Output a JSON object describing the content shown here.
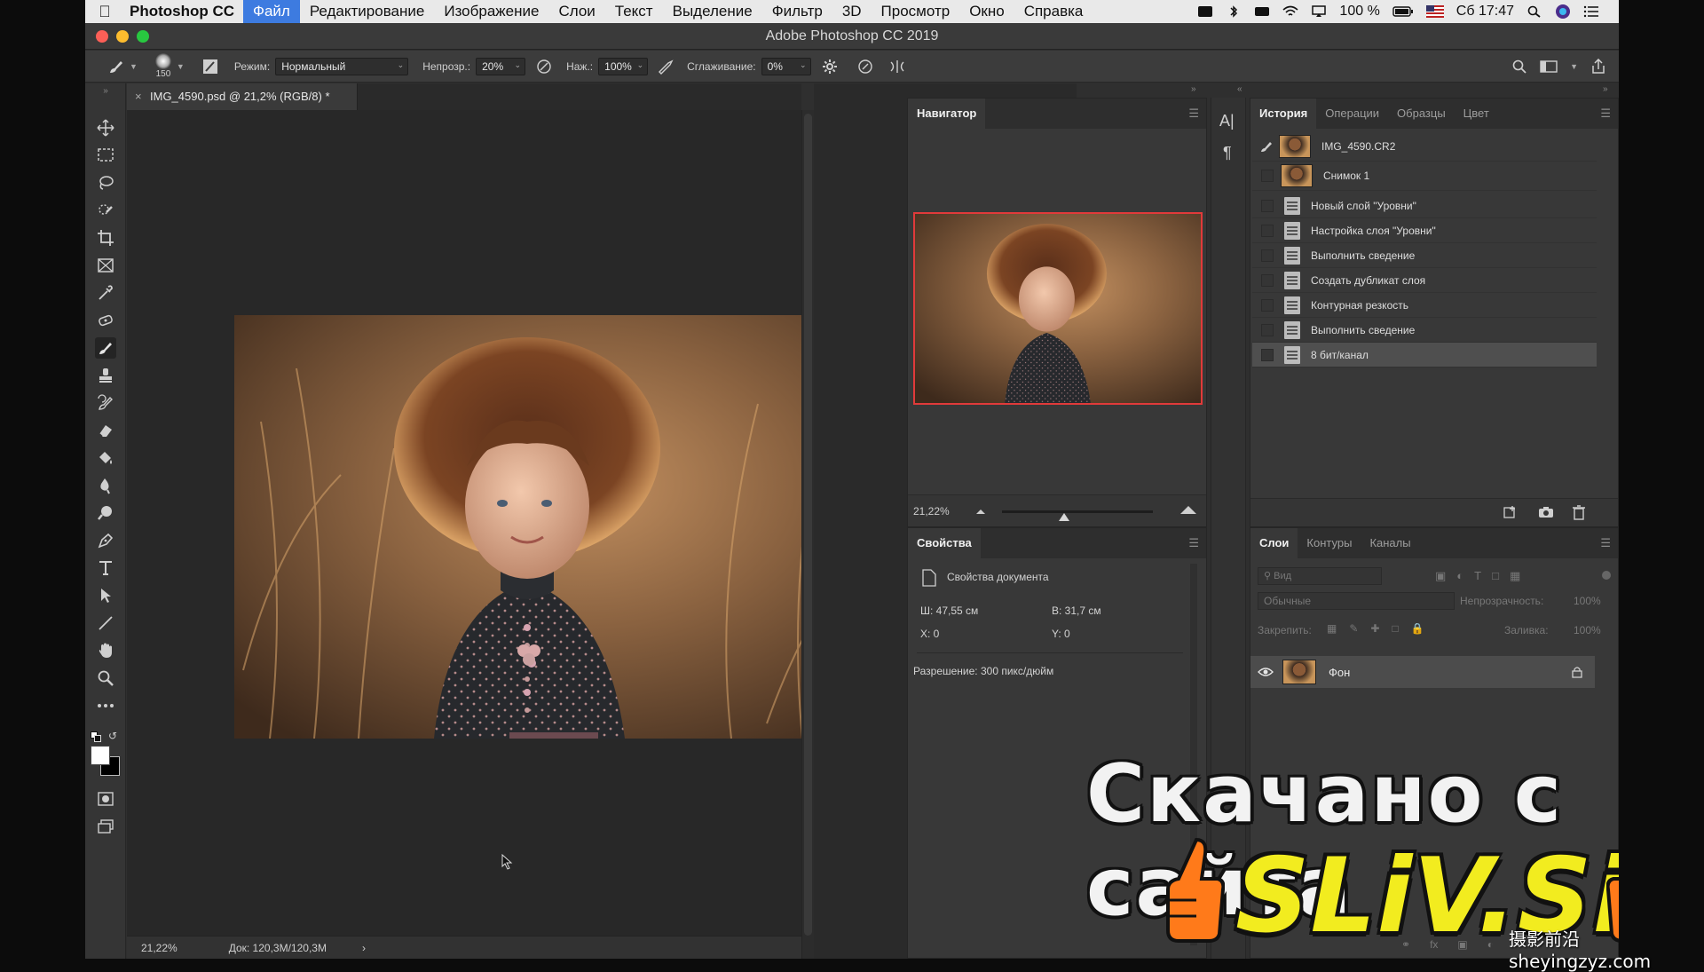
{
  "menubar": {
    "app_name": "Photoshop CC",
    "items": [
      "Файл",
      "Редактирование",
      "Изображение",
      "Слои",
      "Текст",
      "Выделение",
      "Фильтр",
      "3D",
      "Просмотр",
      "Окно",
      "Справка"
    ],
    "battery": "100 %",
    "clock": "Сб 17:47"
  },
  "window": {
    "title": "Adobe Photoshop CC 2019"
  },
  "options": {
    "brush_size": "150",
    "mode_label": "Режим:",
    "mode_value": "Нормальный",
    "opacity_label": "Непрозр.:",
    "opacity_value": "20%",
    "pressure_label": "Наж.:",
    "pressure_value": "100%",
    "smoothing_label": "Сглаживание:",
    "smoothing_value": "0%"
  },
  "document": {
    "tab_title": "IMG_4590.psd @ 21,2% (RGB/8) *",
    "zoom": "21,22%",
    "doc_size": "Док: 120,3M/120,3M"
  },
  "navigator": {
    "title": "Навигатор",
    "zoom": "21,22%"
  },
  "properties": {
    "title": "Свойства",
    "heading": "Свойства документа",
    "width": "Ш: 47,55 см",
    "height": "В: 31,7 см",
    "x": "X: 0",
    "y": "Y: 0",
    "resolution": "Разрешение: 300 пикс/дюйм"
  },
  "history": {
    "tabs": [
      "История",
      "Операции",
      "Образцы",
      "Цвет"
    ],
    "snapshots": [
      "IMG_4590.CR2",
      "Снимок 1"
    ],
    "steps": [
      "Новый слой \"Уровни\"",
      "Настройка слоя \"Уровни\"",
      "Выполнить сведение",
      "Создать дубликат слоя",
      "Контурная резкость",
      "Выполнить сведение",
      "8 бит/канал"
    ]
  },
  "layers": {
    "tabs": [
      "Слои",
      "Контуры",
      "Каналы"
    ],
    "search_placeholder": "Вид",
    "blend_mode": "Обычные",
    "opacity_label": "Непрозрачность:",
    "opacity_value": "100%",
    "lock_label": "Закрепить:",
    "fill_label": "Заливка:",
    "fill_value": "100%",
    "layer_name": "Фон"
  },
  "watermark": {
    "title": "Скачано с сайта",
    "site": "SLiV.SiTE",
    "corner": "摄影前沿sheyingzyz.com"
  }
}
